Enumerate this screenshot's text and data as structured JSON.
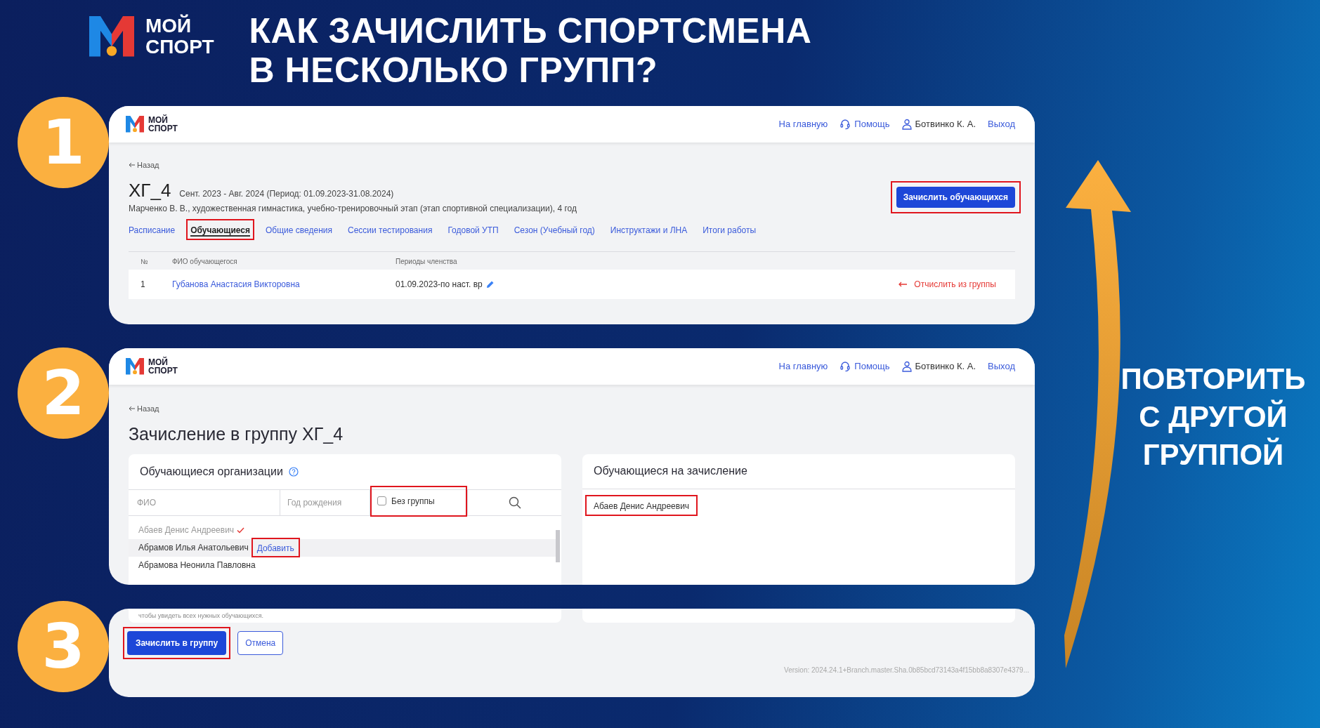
{
  "slide": {
    "logo": [
      "МОЙ",
      "СПОРТ"
    ],
    "title": [
      "КАК ЗАЧИСЛИТЬ СПОРТСМЕНА",
      "В НЕСКОЛЬКО ГРУПП?"
    ],
    "repeat_note": [
      "ПОВТОРИТЬ",
      "С ДРУГОЙ",
      "ГРУППОЙ"
    ]
  },
  "steps": [
    {
      "number": "1",
      "kind": "group_page",
      "header": {
        "logo": [
          "МОЙ",
          "СПОРТ"
        ],
        "nav": [
          {
            "label": "На главную",
            "kind": "link"
          },
          {
            "label": "Помощь",
            "kind": "help"
          },
          {
            "label": "Ботвинко К. А.",
            "kind": "user"
          },
          {
            "label": "Выход",
            "kind": "link"
          }
        ]
      },
      "back": "Назад",
      "group_name": "ХГ_4",
      "period": "Сент. 2023 - Авг. 2024 (Период: 01.09.2023-31.08.2024)",
      "description": "Марченко В. В., художественная гимнастика, учебно-тренировочный этап (этап спортивной специализации), 4 год",
      "enroll_button": {
        "label": "Зачислить обучающихся",
        "highlighted": true
      },
      "tabs": [
        {
          "label": "Расписание",
          "selected": false,
          "highlighted": false
        },
        {
          "label": "Обучающиеся",
          "selected": true,
          "highlighted": true
        },
        {
          "label": "Общие сведения",
          "selected": false,
          "highlighted": false
        },
        {
          "label": "Сессии тестирования",
          "selected": false,
          "highlighted": false
        },
        {
          "label": "Годовой УТП",
          "selected": false,
          "highlighted": false
        },
        {
          "label": "Сезон (Учебный год)",
          "selected": false,
          "highlighted": false
        },
        {
          "label": "Инструктажи и ЛНА",
          "selected": false,
          "highlighted": false
        },
        {
          "label": "Итоги работы",
          "selected": false,
          "highlighted": false
        }
      ],
      "table": {
        "columns": [
          "№",
          "ФИО обучающегося",
          "Периоды членства"
        ],
        "rows": [
          {
            "number": "1",
            "name": "Губанова Анастасия Викторовна",
            "period": "01.09.2023-по наст. вр",
            "action": "Отчислить из группы"
          }
        ]
      }
    },
    {
      "number": "2",
      "kind": "enroll_form",
      "header": {
        "logo": [
          "МОЙ",
          "СПОРТ"
        ],
        "nav": [
          {
            "label": "На главную",
            "kind": "link"
          },
          {
            "label": "Помощь",
            "kind": "help"
          },
          {
            "label": "Ботвинко К. А.",
            "kind": "user"
          },
          {
            "label": "Выход",
            "kind": "link"
          }
        ]
      },
      "back": "Назад",
      "title": "Зачисление в группу ХГ_4",
      "left_card": {
        "title": "Обучающиеся организации",
        "name_placeholder": "ФИО",
        "year_placeholder": "Год рождения",
        "no_group": {
          "label": "Без группы",
          "checked": false,
          "highlighted": true
        },
        "items": [
          {
            "name": "Абаев Денис Андреевич",
            "added": true,
            "hovered": false
          },
          {
            "name": "Абрамов Илья Анатольевич",
            "added": false,
            "hovered": true,
            "action": "Добавить",
            "highlighted": true
          },
          {
            "name": "Абрамова Неонила Павловна",
            "added": false,
            "hovered": false
          }
        ]
      },
      "right_card": {
        "title": "Обучающиеся на зачисление",
        "items": [
          {
            "name": "Абаев Денис Андреевич",
            "highlighted": true
          }
        ]
      }
    },
    {
      "number": "3",
      "kind": "form_footer",
      "hint": "чтобы увидеть всех нужных обучающихся.",
      "submit_button": {
        "label": "Зачислить в группу",
        "highlighted": true
      },
      "cancel_button": {
        "label": "Отмена"
      },
      "version": "Version: 2024.24.1+Branch.master.Sha.0b85bcd73143a4f15bb8a8307e4379..."
    }
  ]
}
